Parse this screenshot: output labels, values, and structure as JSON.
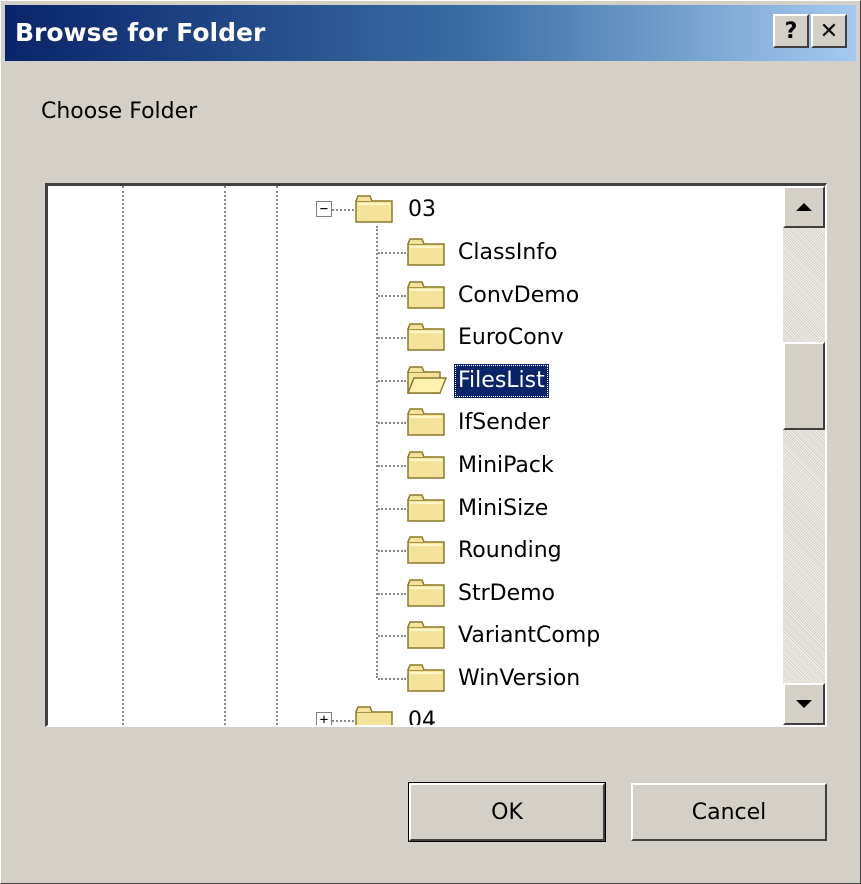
{
  "window": {
    "title": "Browse for Folder",
    "help_glyph": "?",
    "close_glyph": "✕"
  },
  "prompt": "Choose Folder",
  "tree": {
    "parent": {
      "label": "03",
      "expander": "−",
      "expanded": true
    },
    "children": [
      {
        "label": "ClassInfo",
        "selected": false
      },
      {
        "label": "ConvDemo",
        "selected": false
      },
      {
        "label": "EuroConv",
        "selected": false
      },
      {
        "label": "FilesList",
        "selected": true
      },
      {
        "label": "IfSender",
        "selected": false
      },
      {
        "label": "MiniPack",
        "selected": false
      },
      {
        "label": "MiniSize",
        "selected": false
      },
      {
        "label": "Rounding",
        "selected": false
      },
      {
        "label": "StrDemo",
        "selected": false
      },
      {
        "label": "VariantComp",
        "selected": false
      },
      {
        "label": "WinVersion",
        "selected": false
      }
    ],
    "next_sibling": {
      "label": "04",
      "expander": "+",
      "expanded": false
    }
  },
  "buttons": {
    "ok": "OK",
    "cancel": "Cancel"
  },
  "colors": {
    "title_start": "#0a246a",
    "title_end": "#a6caf0",
    "selection": "#0a246a",
    "dialog_face": "#d4d0c8",
    "folder_fill": "#f5e39b",
    "folder_outline": "#8a7a2a"
  },
  "icons": {
    "folder": "folder-icon",
    "folder_open": "folder-open-icon",
    "scroll_up": "scroll-up-arrow-icon",
    "scroll_down": "scroll-down-arrow-icon"
  }
}
